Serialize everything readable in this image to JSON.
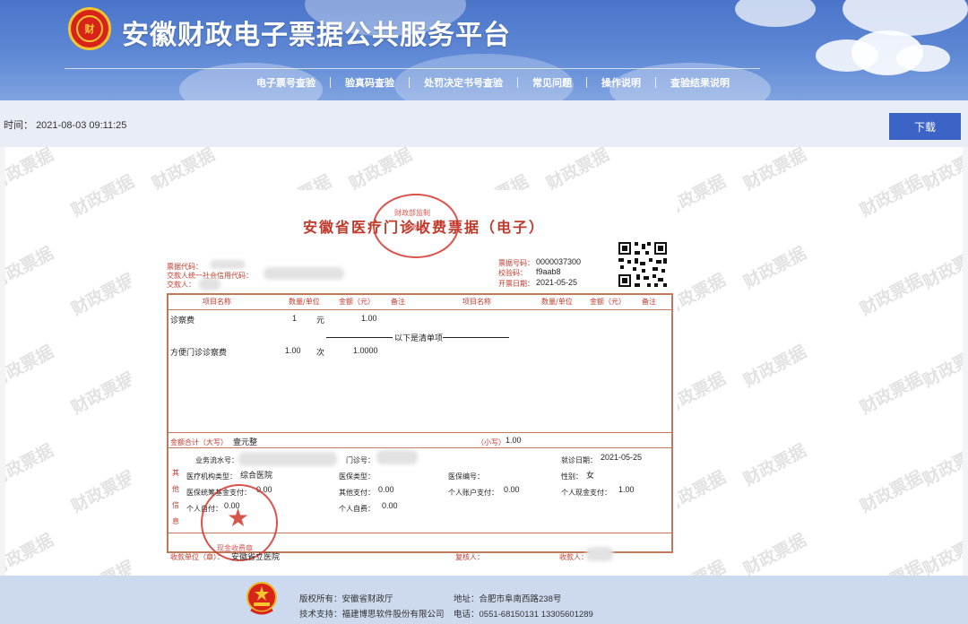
{
  "header": {
    "title": "安徽财政电子票据公共服务平台",
    "emblem_text": "财",
    "nav": [
      "电子票号查验",
      "验真码查验",
      "处罚决定书号查验",
      "常见问题",
      "操作说明",
      "查验结果说明"
    ]
  },
  "timebar": {
    "time_label": "时间：",
    "time_value": "2021-08-03 09:11:25",
    "download_label": "下载"
  },
  "watermark_text": "财政票据",
  "receipt": {
    "title": "安徽省医疗门诊收费票据（电子）",
    "labels": {
      "bill_code": "票据代码：",
      "payer_credit": "交款人统一社会信用代码：",
      "payer": "交款人：",
      "bill_no": "票据号码：",
      "check_code": "校验码：",
      "issue_date": "开票日期："
    },
    "bill_no": "0000037300",
    "check_code": "f9aab8",
    "issue_date": "2021-05-25",
    "table_headers": [
      "项目名称",
      "数量/单位",
      "金额（元）",
      "备注",
      "项目名称",
      "数量/单位",
      "金额（元）",
      "备注"
    ],
    "items": [
      {
        "name": "诊察费",
        "qty": "1",
        "unit": "元",
        "amount": "1.00"
      },
      {
        "name": "方便门诊诊察费",
        "qty": "1.00",
        "unit": "次",
        "amount": "1.0000"
      }
    ],
    "list_note": "以下是清单项",
    "total_label": "金额合计（大写）",
    "total_upper": "壹元整",
    "total_small_label": "（小写）",
    "total_small": "1.00",
    "other_info_label": [
      "其",
      "他",
      "信",
      "息"
    ],
    "info": {
      "serial_label": "业务流水号：",
      "outpatient_label": "门诊号：",
      "visit_date_label": "就诊日期：",
      "visit_date": "2021-05-25",
      "inst_type_label": "医疗机构类型：",
      "inst_type": "综合医院",
      "ins_type_label": "医保类型：",
      "ins_no_label": "医保编号：",
      "gender_label": "性别：",
      "gender": "女",
      "fund_label": "医保统筹基金支付：",
      "fund": "0.00",
      "other_pay_label": "其他支付：",
      "other_pay": "0.00",
      "account_label": "个人账户支付：",
      "account": "0.00",
      "cash_label": "个人现金支付：",
      "cash": "1.00",
      "self_pay_label": "个人自付：",
      "self_pay": "0.00",
      "self_fee_label": "个人自费：",
      "self_fee": "0.00"
    },
    "payee_unit_label": "收款单位（章）：",
    "payee_unit": "安徽省立医院",
    "reviewer_label": "复核人：",
    "payee_label": "收款人：",
    "seal_top": [
      "财政部监制",
      "安徽省"
    ],
    "seal_bottom": "现金收费章"
  },
  "footer": {
    "copyright": "版权所有：安徽省财政厅",
    "support": "技术支持：福建博思软件股份有限公司",
    "address": "地址：合肥市阜南西路238号",
    "phone": "电话：0551-68150131 13305601289"
  }
}
